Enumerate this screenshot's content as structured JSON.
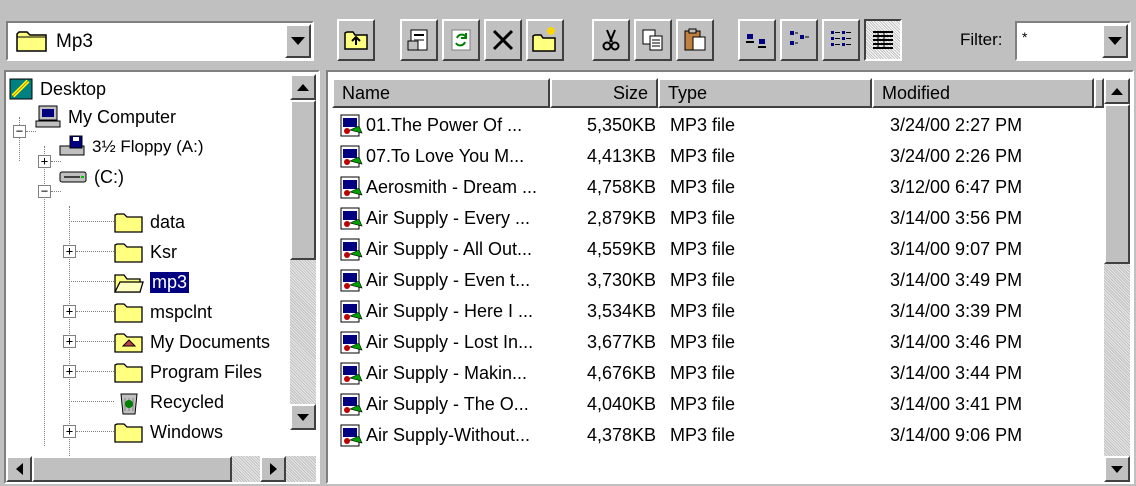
{
  "address": {
    "value": "Mp3"
  },
  "toolbar": {
    "buttons": [
      {
        "name": "up-folder-button",
        "icon": "up-folder-icon"
      },
      {
        "name": "properties-button",
        "icon": "properties-icon"
      },
      {
        "name": "refresh-button",
        "icon": "refresh-icon"
      },
      {
        "name": "delete-button",
        "icon": "delete-x-icon"
      },
      {
        "name": "new-folder-button",
        "icon": "new-folder-icon"
      },
      {
        "name": "cut-button",
        "icon": "scissors-icon"
      },
      {
        "name": "copy-button",
        "icon": "copy-icon"
      },
      {
        "name": "paste-button",
        "icon": "paste-icon"
      },
      {
        "name": "view-large-icons-button",
        "icon": "large-icons-icon"
      },
      {
        "name": "view-small-icons-button",
        "icon": "small-icons-icon"
      },
      {
        "name": "view-list-button",
        "icon": "list-view-icon"
      },
      {
        "name": "view-details-button",
        "icon": "details-view-icon"
      }
    ],
    "filter_label": "Filter:",
    "filter_value": "*"
  },
  "tree": {
    "items": [
      {
        "label": "Desktop",
        "icon": "desktop-icon"
      },
      {
        "label": "My Computer",
        "icon": "computer-icon"
      },
      {
        "label": "3½ Floppy (A:)",
        "icon": "floppy-drive-icon"
      },
      {
        "label": "(C:)",
        "icon": "hard-drive-icon"
      },
      {
        "label": "data",
        "icon": "folder-icon"
      },
      {
        "label": "Ksr",
        "icon": "folder-icon"
      },
      {
        "label": "mp3",
        "icon": "open-folder-icon",
        "selected": true
      },
      {
        "label": "mspclnt",
        "icon": "folder-icon"
      },
      {
        "label": "My Documents",
        "icon": "my-documents-icon"
      },
      {
        "label": "Program Files",
        "icon": "folder-icon"
      },
      {
        "label": "Recycled",
        "icon": "recycle-bin-icon"
      },
      {
        "label": "Windows",
        "icon": "folder-icon"
      }
    ]
  },
  "list": {
    "columns": [
      "Name",
      "Size",
      "Type",
      "Modified"
    ],
    "rows": [
      {
        "name": "01.The Power Of ...",
        "size": "5,350KB",
        "type": "MP3 file",
        "modified": "3/24/00 2:27 PM"
      },
      {
        "name": "07.To Love You M...",
        "size": "4,413KB",
        "type": "MP3 file",
        "modified": "3/24/00 2:26 PM"
      },
      {
        "name": "Aerosmith - Dream ...",
        "size": "4,758KB",
        "type": "MP3 file",
        "modified": "3/12/00 6:47 PM"
      },
      {
        "name": "Air Supply -  Every ...",
        "size": "2,879KB",
        "type": "MP3 file",
        "modified": "3/14/00 3:56 PM"
      },
      {
        "name": "Air Supply - All Out...",
        "size": "4,559KB",
        "type": "MP3 file",
        "modified": "3/14/00 9:07 PM"
      },
      {
        "name": "Air Supply - Even t...",
        "size": "3,730KB",
        "type": "MP3 file",
        "modified": "3/14/00 3:49 PM"
      },
      {
        "name": "Air Supply - Here I ...",
        "size": "3,534KB",
        "type": "MP3 file",
        "modified": "3/14/00 3:39 PM"
      },
      {
        "name": "Air Supply - Lost In...",
        "size": "3,677KB",
        "type": "MP3 file",
        "modified": "3/14/00 3:46 PM"
      },
      {
        "name": "Air Supply - Makin...",
        "size": "4,676KB",
        "type": "MP3 file",
        "modified": "3/14/00 3:44 PM"
      },
      {
        "name": "Air Supply - The O...",
        "size": "4,040KB",
        "type": "MP3 file",
        "modified": "3/14/00 3:41 PM"
      },
      {
        "name": "Air Supply-Without...",
        "size": "4,378KB",
        "type": "MP3 file",
        "modified": "3/14/00 9:06 PM"
      }
    ]
  }
}
